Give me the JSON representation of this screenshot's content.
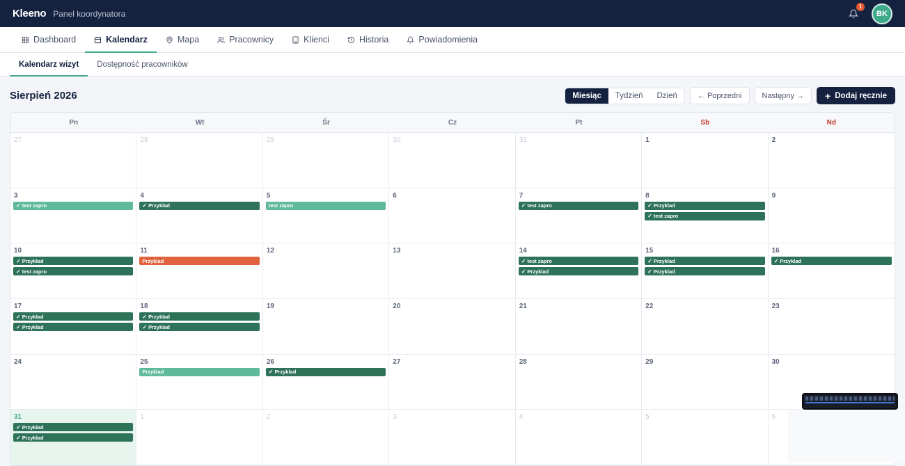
{
  "header": {
    "brand": "Kleeno",
    "subtitle": "Panel koordynatora",
    "notifications_count": "1",
    "avatar_initials": "BK"
  },
  "nav": {
    "items": [
      {
        "label": "Dashboard",
        "icon": "grid-icon",
        "active": false
      },
      {
        "label": "Kalendarz",
        "icon": "calendar-icon",
        "active": true
      },
      {
        "label": "Mapa",
        "icon": "map-pin-icon",
        "active": false
      },
      {
        "label": "Pracownicy",
        "icon": "users-icon",
        "active": false
      },
      {
        "label": "Klienci",
        "icon": "building-icon",
        "active": false
      },
      {
        "label": "Historia",
        "icon": "history-icon",
        "active": false
      },
      {
        "label": "Powiadomienia",
        "icon": "bell-icon",
        "active": false
      }
    ]
  },
  "subnav": {
    "items": [
      {
        "label": "Kalendarz wizyt",
        "active": true
      },
      {
        "label": "Dostępność pracowników",
        "active": false
      }
    ]
  },
  "toolbar": {
    "title": "Sierpień 2026",
    "views": [
      {
        "label": "Miesiąc",
        "active": true
      },
      {
        "label": "Tydzień",
        "active": false
      },
      {
        "label": "Dzień",
        "active": false
      }
    ],
    "prev": "← Poprzedni",
    "next": "Następny →",
    "add": "Dodaj ręcznie"
  },
  "weekdays": [
    {
      "label": "Pn",
      "weekend": false
    },
    {
      "label": "Wt",
      "weekend": false
    },
    {
      "label": "Śr",
      "weekend": false
    },
    {
      "label": "Cz",
      "weekend": false
    },
    {
      "label": "Pt",
      "weekend": false
    },
    {
      "label": "Sb",
      "weekend": true
    },
    {
      "label": "Nd",
      "weekend": true
    }
  ],
  "colors": {
    "navy": "#14213f",
    "accent": "#3fa98a",
    "event_dark": "#2e7259",
    "event_light": "#5fb99b",
    "event_orange": "#e0633d"
  },
  "days": [
    {
      "n": "27",
      "other": true,
      "events": []
    },
    {
      "n": "28",
      "other": true,
      "events": []
    },
    {
      "n": "29",
      "other": true,
      "events": []
    },
    {
      "n": "30",
      "other": true,
      "events": []
    },
    {
      "n": "31",
      "other": true,
      "events": []
    },
    {
      "n": "1",
      "events": []
    },
    {
      "n": "2",
      "events": []
    },
    {
      "n": "3",
      "events": [
        {
          "label": "test zapro",
          "color": "light",
          "check": true
        }
      ]
    },
    {
      "n": "4",
      "events": [
        {
          "label": "Przyklad",
          "color": "dark",
          "check": true
        }
      ]
    },
    {
      "n": "5",
      "events": [
        {
          "label": "test zapro",
          "color": "light",
          "check": false
        }
      ]
    },
    {
      "n": "6",
      "events": []
    },
    {
      "n": "7",
      "events": [
        {
          "label": "test zapro",
          "color": "dark",
          "check": true
        }
      ]
    },
    {
      "n": "8",
      "events": [
        {
          "label": "Przyklad",
          "color": "dark",
          "check": true
        },
        {
          "label": "test zapro",
          "color": "dark",
          "check": true
        }
      ]
    },
    {
      "n": "9",
      "events": []
    },
    {
      "n": "10",
      "events": [
        {
          "label": "Przyklad",
          "color": "dark",
          "check": true
        },
        {
          "label": "test zapro",
          "color": "dark",
          "check": true
        }
      ]
    },
    {
      "n": "11",
      "events": [
        {
          "label": "Przyklad",
          "color": "orange",
          "check": false
        }
      ]
    },
    {
      "n": "12",
      "events": []
    },
    {
      "n": "13",
      "events": []
    },
    {
      "n": "14",
      "events": [
        {
          "label": "test zapro",
          "color": "dark",
          "check": true
        },
        {
          "label": "Przyklad",
          "color": "dark",
          "check": true
        }
      ]
    },
    {
      "n": "15",
      "events": [
        {
          "label": "Przyklad",
          "color": "dark",
          "check": true
        },
        {
          "label": "Przyklad",
          "color": "dark",
          "check": true
        }
      ]
    },
    {
      "n": "16",
      "events": [
        {
          "label": "Przyklad",
          "color": "dark",
          "check": true
        }
      ]
    },
    {
      "n": "17",
      "events": [
        {
          "label": "Przyklad",
          "color": "dark",
          "check": true
        },
        {
          "label": "Przyklad",
          "color": "dark",
          "check": true
        }
      ]
    },
    {
      "n": "18",
      "events": [
        {
          "label": "Przyklad",
          "color": "dark",
          "check": true
        },
        {
          "label": "Przyklad",
          "color": "dark",
          "check": true
        }
      ]
    },
    {
      "n": "19",
      "events": []
    },
    {
      "n": "20",
      "events": []
    },
    {
      "n": "21",
      "events": []
    },
    {
      "n": "22",
      "events": []
    },
    {
      "n": "23",
      "events": []
    },
    {
      "n": "24",
      "events": []
    },
    {
      "n": "25",
      "events": [
        {
          "label": "Przyklad",
          "color": "light",
          "check": false
        }
      ]
    },
    {
      "n": "26",
      "events": [
        {
          "label": "Przyklad",
          "color": "dark",
          "check": true
        }
      ]
    },
    {
      "n": "27",
      "events": []
    },
    {
      "n": "28",
      "events": []
    },
    {
      "n": "29",
      "events": []
    },
    {
      "n": "30",
      "events": []
    },
    {
      "n": "31",
      "today": true,
      "events": [
        {
          "label": "Przyklad",
          "color": "dark",
          "check": true
        },
        {
          "label": "Przyklad",
          "color": "dark",
          "check": true
        }
      ]
    },
    {
      "n": "1",
      "other": true,
      "events": []
    },
    {
      "n": "2",
      "other": true,
      "events": []
    },
    {
      "n": "3",
      "other": true,
      "events": []
    },
    {
      "n": "4",
      "other": true,
      "events": []
    },
    {
      "n": "5",
      "other": true,
      "events": []
    },
    {
      "n": "6",
      "other": true,
      "events": []
    }
  ]
}
